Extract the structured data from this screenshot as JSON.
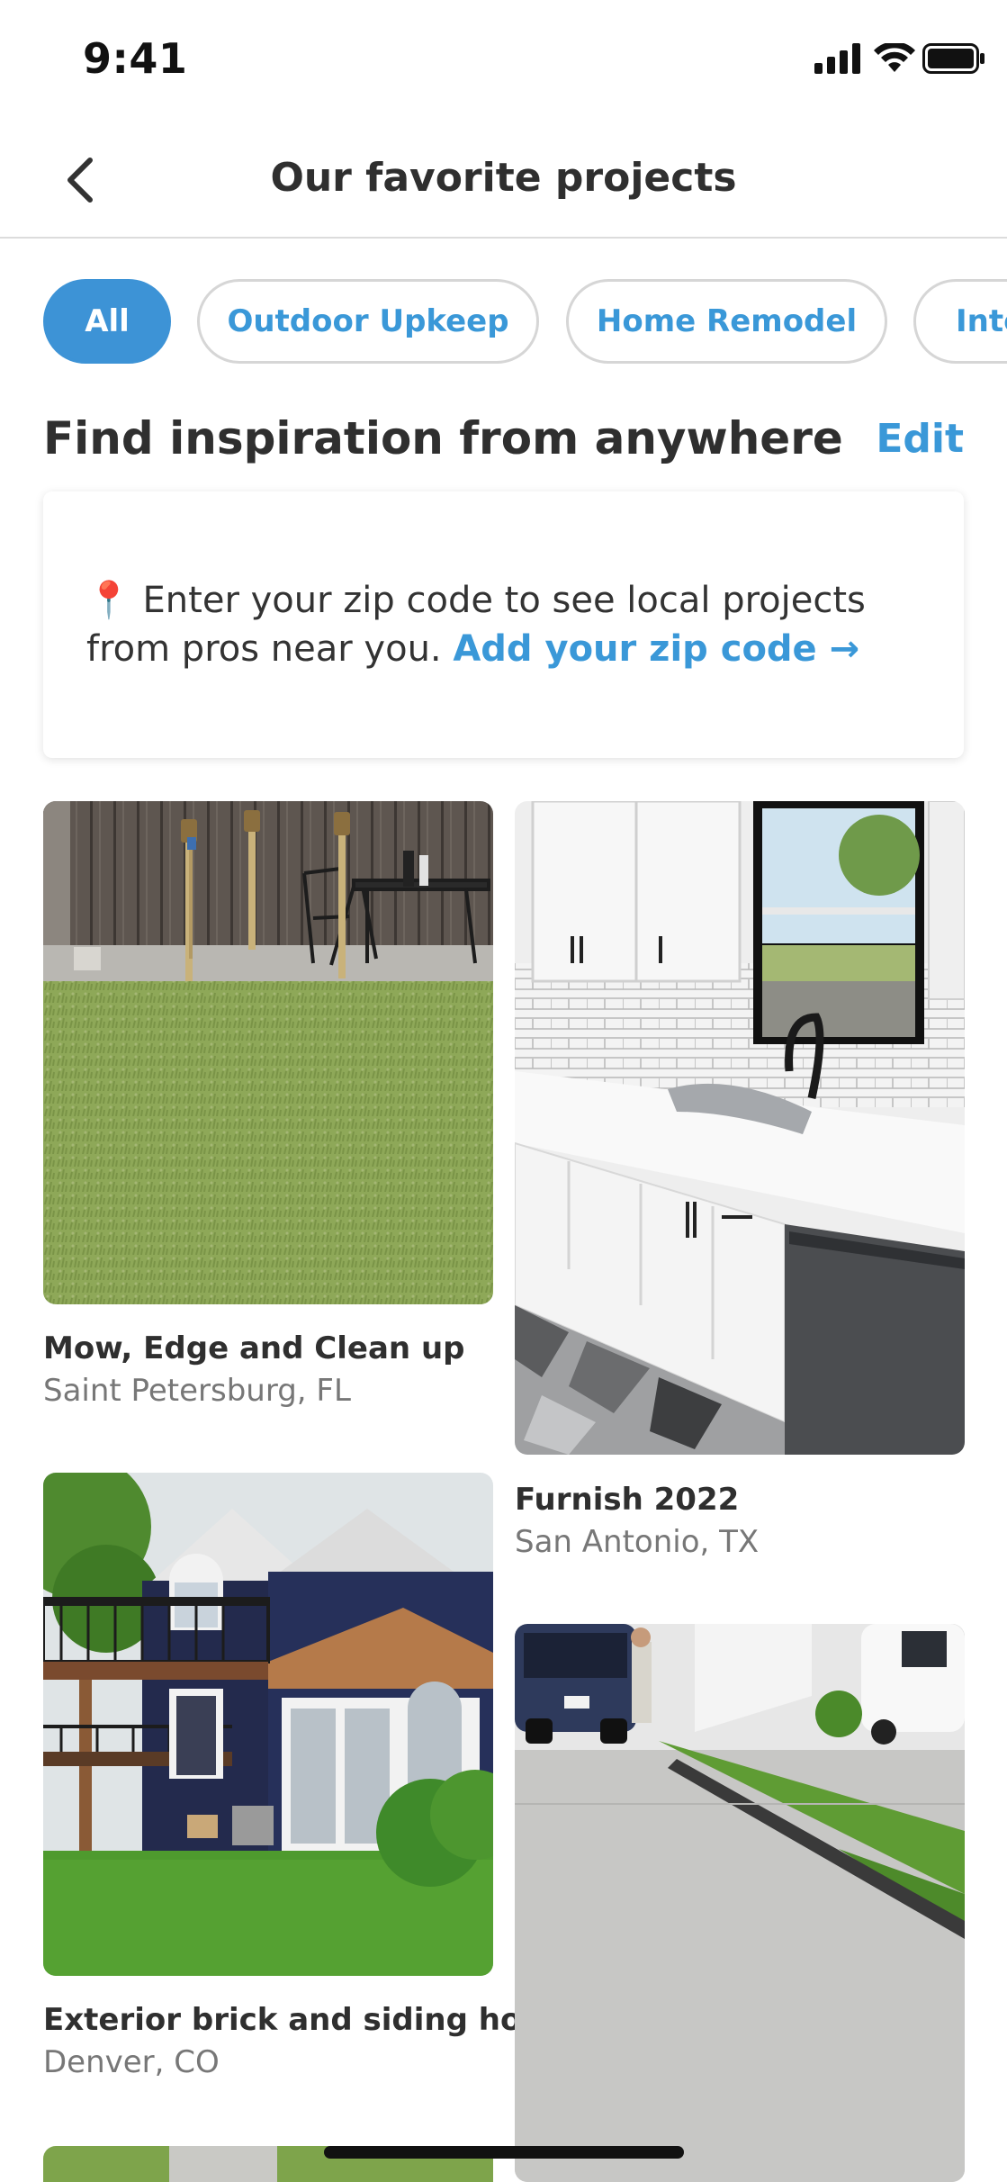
{
  "status": {
    "time": "9:41"
  },
  "nav": {
    "title": "Our favorite projects"
  },
  "filters": [
    {
      "label": "All",
      "active": true
    },
    {
      "label": "Outdoor Upkeep",
      "active": false
    },
    {
      "label": "Home Remodel",
      "active": false
    },
    {
      "label": "Inte",
      "active": false
    }
  ],
  "section": {
    "title": "Find inspiration from anywhere",
    "edit_label": "Edit"
  },
  "zip_card": {
    "pin_icon": "📍",
    "text": " Enter your zip code to see local projects from pros near you. ",
    "link": "Add your zip code →"
  },
  "projects": [
    {
      "title": "Mow, Edge and Clean up",
      "location": "Saint Petersburg, FL",
      "image": "backyard-lawn-photo"
    },
    {
      "title": "Furnish 2022",
      "location": "San Antonio, TX",
      "image": "kitchen-photo"
    },
    {
      "title": "Exterior brick and siding ho...",
      "location": "Denver, CO",
      "image": "house-exterior-photo"
    },
    {
      "title": "",
      "location": "",
      "image": "driveway-photo"
    }
  ],
  "colors": {
    "accent": "#3d93d6",
    "link": "#3a98d8",
    "text": "#2f2f2f",
    "muted": "#777777"
  }
}
